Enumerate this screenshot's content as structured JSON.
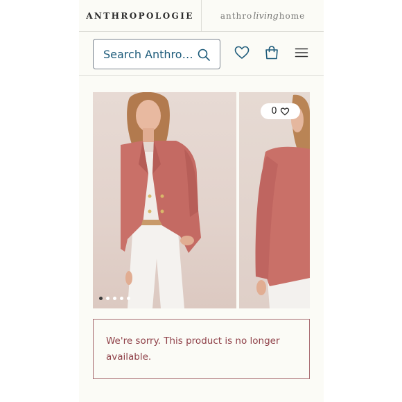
{
  "header": {
    "brand": "ANTHROPOLOGIE",
    "sub_brand": {
      "left": "anthro",
      "middle": "living",
      "right": "home"
    }
  },
  "search": {
    "placeholder": "Search Anthro…"
  },
  "nav": {
    "icons": [
      "search-icon",
      "heart-icon",
      "shopping-bag-icon",
      "menu-icon"
    ]
  },
  "gallery": {
    "images": [
      "model-front-blazer",
      "model-side-blazer"
    ],
    "dot_count": 5,
    "active_dot": 1,
    "favorite_count": "0"
  },
  "notice": {
    "message": "We're sorry. This product is no longer available."
  },
  "colors": {
    "brand_text": "#2c2c2c",
    "search_text": "#1d5b7a",
    "icon": "#1d5b7a",
    "notice_text": "#8e3f47",
    "notice_border": "#a76b70",
    "blazer": "#c97068"
  }
}
